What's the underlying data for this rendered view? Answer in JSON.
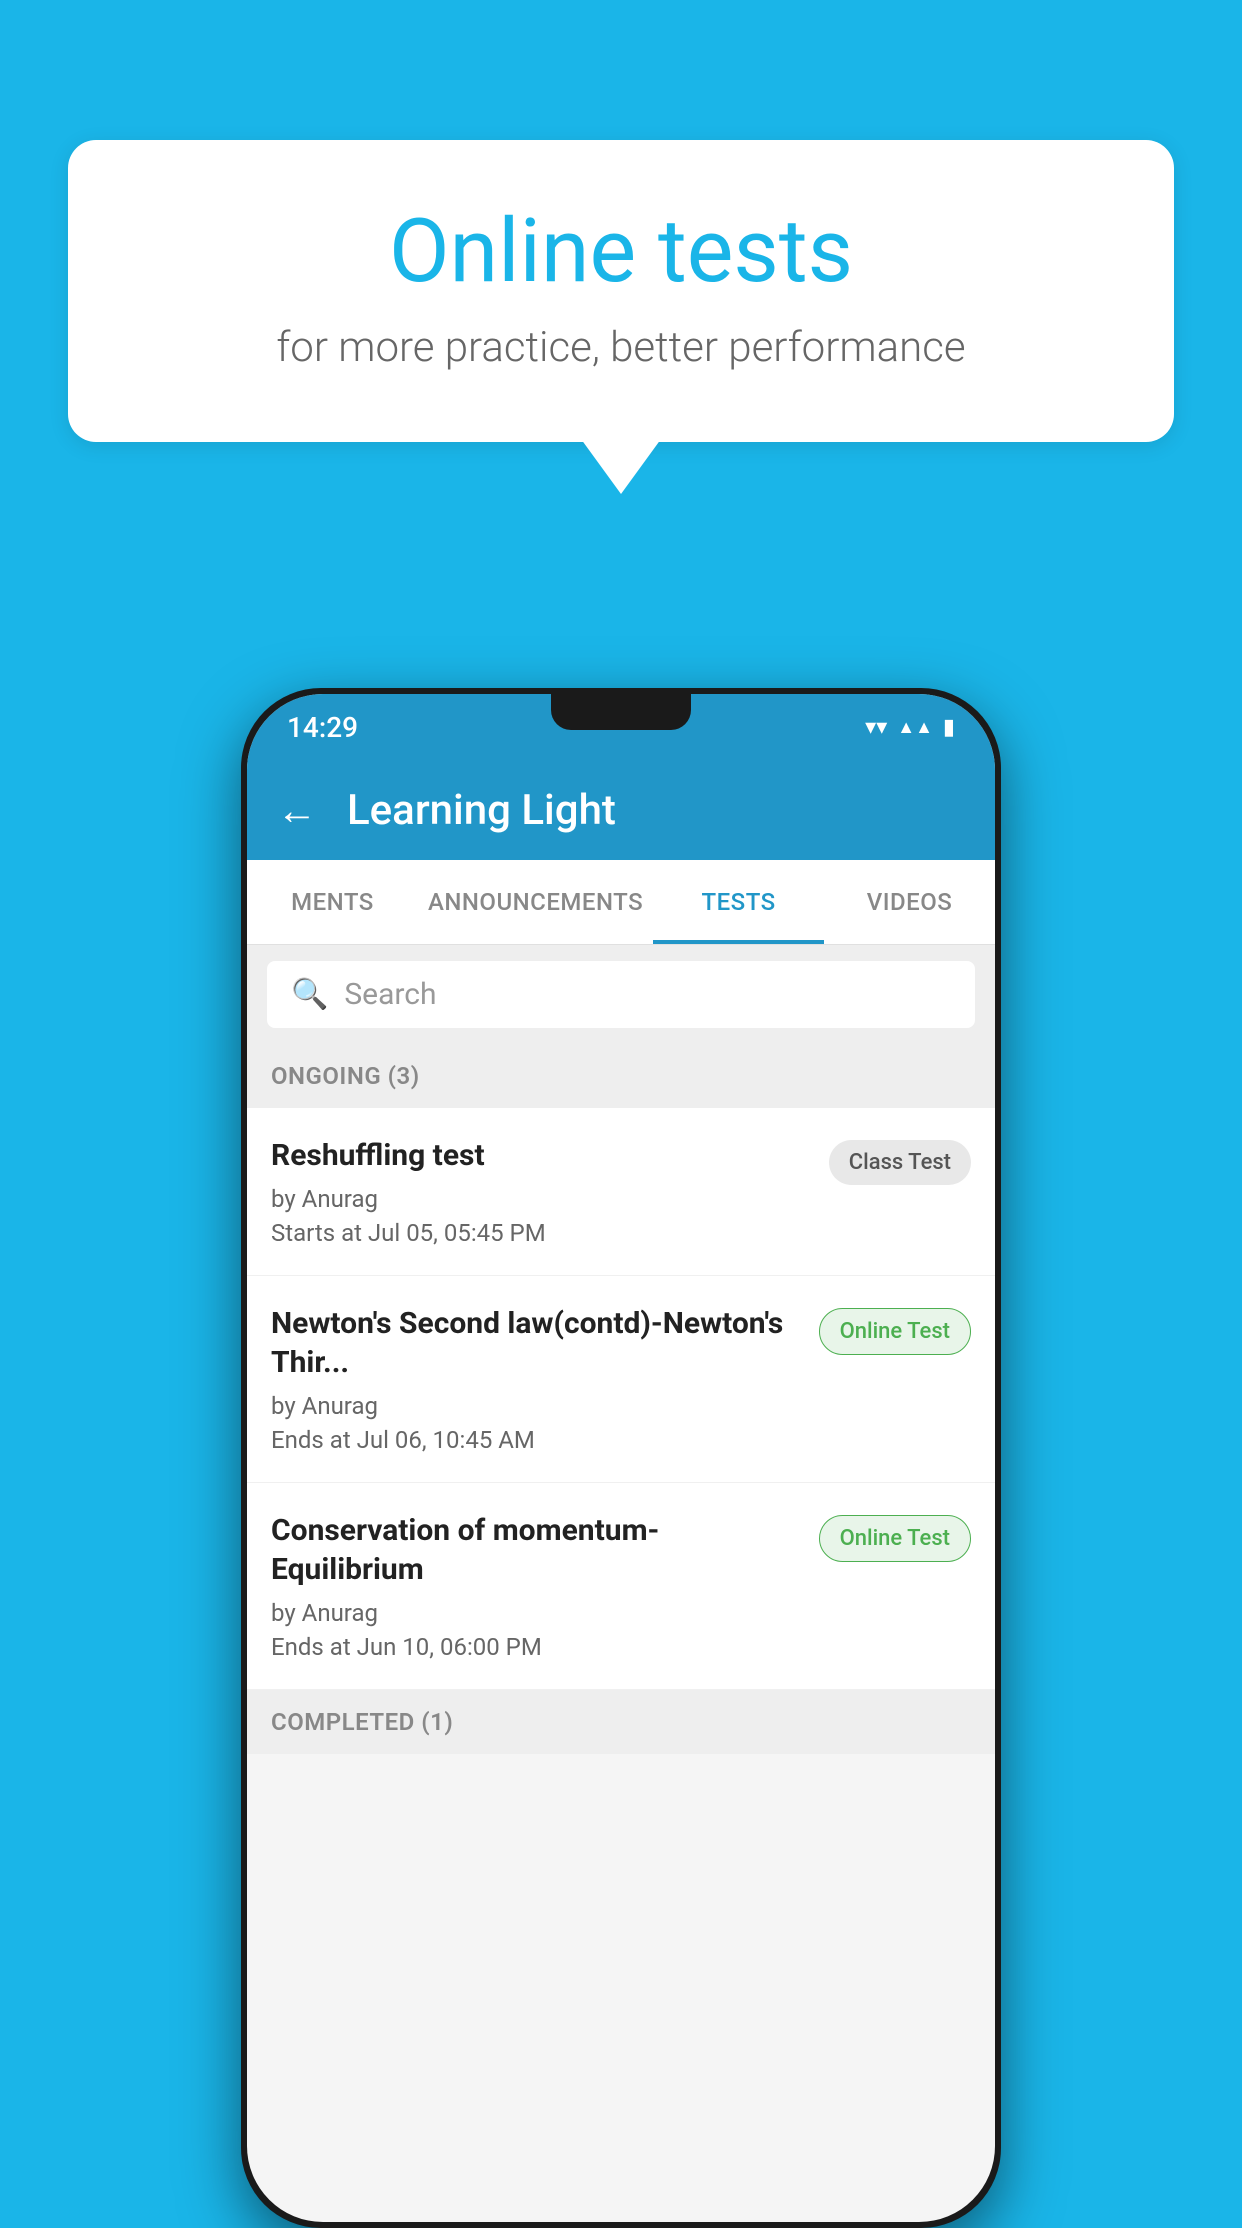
{
  "background_color": "#1ab5e8",
  "speech_bubble": {
    "title": "Online tests",
    "subtitle": "for more practice, better performance"
  },
  "phone": {
    "status_bar": {
      "time": "14:29",
      "icons": [
        "wifi",
        "signal",
        "battery"
      ]
    },
    "app_bar": {
      "title": "Learning Light",
      "back_label": "←"
    },
    "tabs": [
      {
        "label": "MENTS",
        "active": false
      },
      {
        "label": "ANNOUNCEMENTS",
        "active": false
      },
      {
        "label": "TESTS",
        "active": true
      },
      {
        "label": "VIDEOS",
        "active": false
      }
    ],
    "search": {
      "placeholder": "Search"
    },
    "ongoing_section": {
      "title": "ONGOING (3)",
      "tests": [
        {
          "name": "Reshuffling test",
          "author": "by Anurag",
          "date": "Starts at  Jul 05, 05:45 PM",
          "badge": "Class Test",
          "badge_type": "class"
        },
        {
          "name": "Newton's Second law(contd)-Newton's Thir...",
          "author": "by Anurag",
          "date": "Ends at  Jul 06, 10:45 AM",
          "badge": "Online Test",
          "badge_type": "online"
        },
        {
          "name": "Conservation of momentum-Equilibrium",
          "author": "by Anurag",
          "date": "Ends at  Jun 10, 06:00 PM",
          "badge": "Online Test",
          "badge_type": "online"
        }
      ]
    },
    "completed_section": {
      "title": "COMPLETED (1)"
    }
  }
}
